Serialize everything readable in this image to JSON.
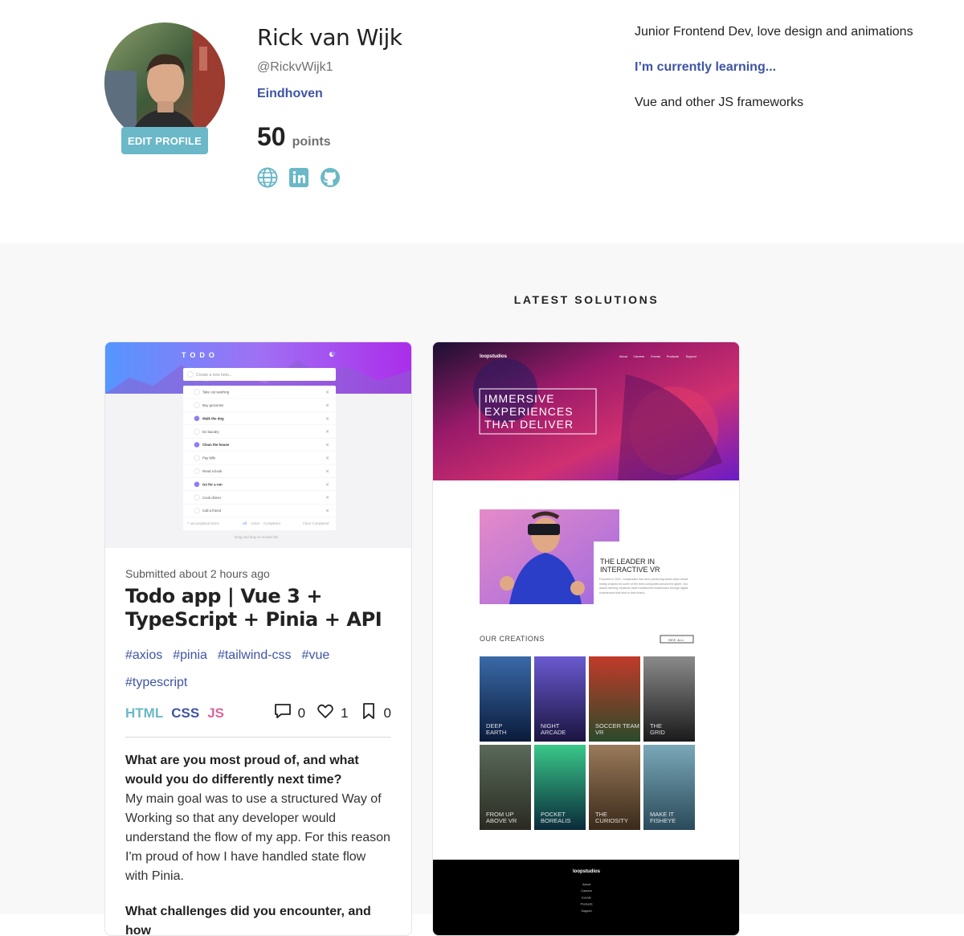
{
  "profile": {
    "name": "Rick van Wijk",
    "handle": "@RickvWijk1",
    "location": "Eindhoven",
    "points": "50",
    "points_label": "points",
    "edit_label": "EDIT PROFILE",
    "bio": "Junior Frontend Dev, love design and animations",
    "learning_title": "I’m currently learning...",
    "learning": "Vue and other JS frameworks",
    "socials": [
      "globe-icon",
      "linkedin-icon",
      "github-icon"
    ]
  },
  "solutions": {
    "title": "LATEST SOLUTIONS",
    "card1": {
      "submitted": "Submitted about 2 hours ago",
      "title": "Todo app | Vue 3 + TypeScript + Pinia + API",
      "tags": [
        "#axios",
        "#pinia",
        "#tailwind-css",
        "#vue",
        "#typescript"
      ],
      "langs": [
        "HTML",
        "CSS",
        "JS"
      ],
      "comments": "0",
      "likes": "1",
      "bookmarks": "0",
      "question": "What are you most proud of, and what would you do differently next time?",
      "answer": "My main goal was to use a structured Way of Working so that any developer would understand the flow of my app. For this reason I'm proud of how I have handled state flow with Pinia.",
      "question2": "What challenges did you encounter, and how"
    },
    "card2": {
      "brand": "loopstudios",
      "nav": [
        "About",
        "Careers",
        "Events",
        "Products",
        "Support"
      ],
      "hero_text": [
        "IMMERSIVE",
        "EXPERIENCES",
        "THAT DELIVER"
      ],
      "leader_title": [
        "THE LEADER IN",
        "INTERACTIVE VR"
      ],
      "leader_text": "Founded in 2011, Loopstudios has been producing world-class virtual reality projects for some of the best companies around the globe. Our award-winning creations have transformed businesses through digital experiences that bind to their brand.",
      "creations_title": "OUR CREATIONS",
      "see_all": "SEE ALL",
      "creations": [
        "DEEP EARTH",
        "NIGHT ARCADE",
        "SOCCER TEAM VR",
        "THE GRID",
        "FROM UP ABOVE VR",
        "POCKET BOREALIS",
        "THE CURIOSITY",
        "MAKE IT FISHEYE"
      ],
      "footer_brand": "loopstudios",
      "footer_links": [
        "About",
        "Careers",
        "Events",
        "Products",
        "Support"
      ]
    }
  },
  "todo_shot": {
    "header": "TODO",
    "placeholder": "Create a new todo...",
    "items": [
      "Take out washing",
      "Buy groceries",
      "Walk the dog",
      "Do laundry",
      "Clean the house",
      "Pay bills",
      "Read a book",
      "Go for a run",
      "Cook dinner",
      "Call a friend"
    ],
    "done": [
      false,
      false,
      true,
      false,
      true,
      false,
      false,
      true,
      false,
      false
    ],
    "footer_left": "7 uncompleted items",
    "filters": [
      "All",
      "Active",
      "Completed"
    ],
    "footer_right": "Clear Completed",
    "hint": "Drag and drop to reorder list"
  },
  "colors": {
    "accent_teal": "#6ab8c8",
    "accent_blue": "#3e54a3",
    "accent_pink": "#d9669a",
    "section_bg": "#f8f8f8"
  }
}
